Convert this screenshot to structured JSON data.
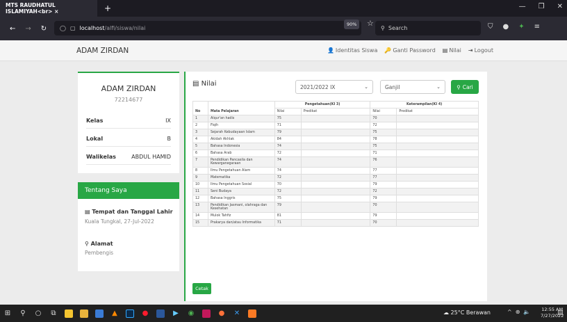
{
  "browser": {
    "tab_title": "MTS RAUDHATUL ISLAMIYAH<br> ×",
    "new_tab": "+",
    "url_host": "localhost",
    "url_path": "/alfi/siswa/nilai",
    "zoom": "90%",
    "search_placeholder": "Search"
  },
  "site": {
    "brand": "ADAM ZIRDAN",
    "nav": {
      "identitas": "Identitas Siswa",
      "password": "Ganti Password",
      "nilai": "Nilai",
      "logout": "Logout"
    }
  },
  "profile": {
    "name": "ADAM ZIRDAN",
    "nis": "72214677",
    "rows": [
      {
        "label": "Kelas",
        "value": "IX"
      },
      {
        "label": "Lokal",
        "value": "B"
      },
      {
        "label": "Walikelas",
        "value": "ABDUL HAMID"
      }
    ]
  },
  "about": {
    "header": "Tentang Saya",
    "ttl_label": "Tempat dan Tanggal Lahir",
    "ttl_value": "Kuala Tungkal, 27-Jul-2022",
    "alamat_label": "Alamat",
    "alamat_value": "Pembengis"
  },
  "grades": {
    "title": "Nilai",
    "year_select": "2021/2022 IX",
    "semester_select": "Ganjil",
    "search_button": "Cari",
    "print_button": "Cetak",
    "headers": {
      "no": "No",
      "mapel": "Mata Pelajaran",
      "pengetahuan": "Pengetahuan(KI 3)",
      "keterampilan": "Keterampilan(KI 4)",
      "nilai": "Nilai",
      "predikat": "Predikat"
    },
    "rows": [
      {
        "no": "1",
        "mapel": "Alqur'an hadis",
        "n3": "75",
        "p3": "",
        "n4": "70",
        "p4": ""
      },
      {
        "no": "2",
        "mapel": "Fiqih",
        "n3": "71",
        "p3": "",
        "n4": "72",
        "p4": ""
      },
      {
        "no": "3",
        "mapel": "Sejarah Kebudayaan Islam",
        "n3": "79",
        "p3": "",
        "n4": "75",
        "p4": ""
      },
      {
        "no": "4",
        "mapel": "Akidah Akhlak",
        "n3": "84",
        "p3": "",
        "n4": "78",
        "p4": ""
      },
      {
        "no": "5",
        "mapel": "Bahasa Indonesia",
        "n3": "74",
        "p3": "",
        "n4": "75",
        "p4": ""
      },
      {
        "no": "6",
        "mapel": "Bahasa Arab",
        "n3": "72",
        "p3": "",
        "n4": "71",
        "p4": ""
      },
      {
        "no": "7",
        "mapel": "Pendidikan Pancasila dan Kewarganegaraan",
        "n3": "74",
        "p3": "",
        "n4": "76",
        "p4": ""
      },
      {
        "no": "8",
        "mapel": "Ilmu Pengetahuan Alam",
        "n3": "74",
        "p3": "",
        "n4": "77",
        "p4": ""
      },
      {
        "no": "9",
        "mapel": "Matematika",
        "n3": "72",
        "p3": "",
        "n4": "77",
        "p4": ""
      },
      {
        "no": "10",
        "mapel": "Ilmu Pengetahuan Sosial",
        "n3": "70",
        "p3": "",
        "n4": "79",
        "p4": ""
      },
      {
        "no": "11",
        "mapel": "Seni Budaya",
        "n3": "72",
        "p3": "",
        "n4": "72",
        "p4": ""
      },
      {
        "no": "12",
        "mapel": "Bahasa Inggris",
        "n3": "75",
        "p3": "",
        "n4": "79",
        "p4": ""
      },
      {
        "no": "13",
        "mapel": "Pendidikan Jasmani, olahraga dan Kesehatan",
        "n3": "79",
        "p3": "",
        "n4": "70",
        "p4": ""
      },
      {
        "no": "14",
        "mapel": "Mulok Tahfiz",
        "n3": "81",
        "p3": "",
        "n4": "79",
        "p4": ""
      },
      {
        "no": "15",
        "mapel": "Prakarya dan/atau Informatika",
        "n3": "71",
        "p3": "",
        "n4": "70",
        "p4": ""
      }
    ]
  },
  "taskbar": {
    "weather": "25°C Berawan",
    "time": "12:55 AM",
    "date": "7/27/2022"
  }
}
